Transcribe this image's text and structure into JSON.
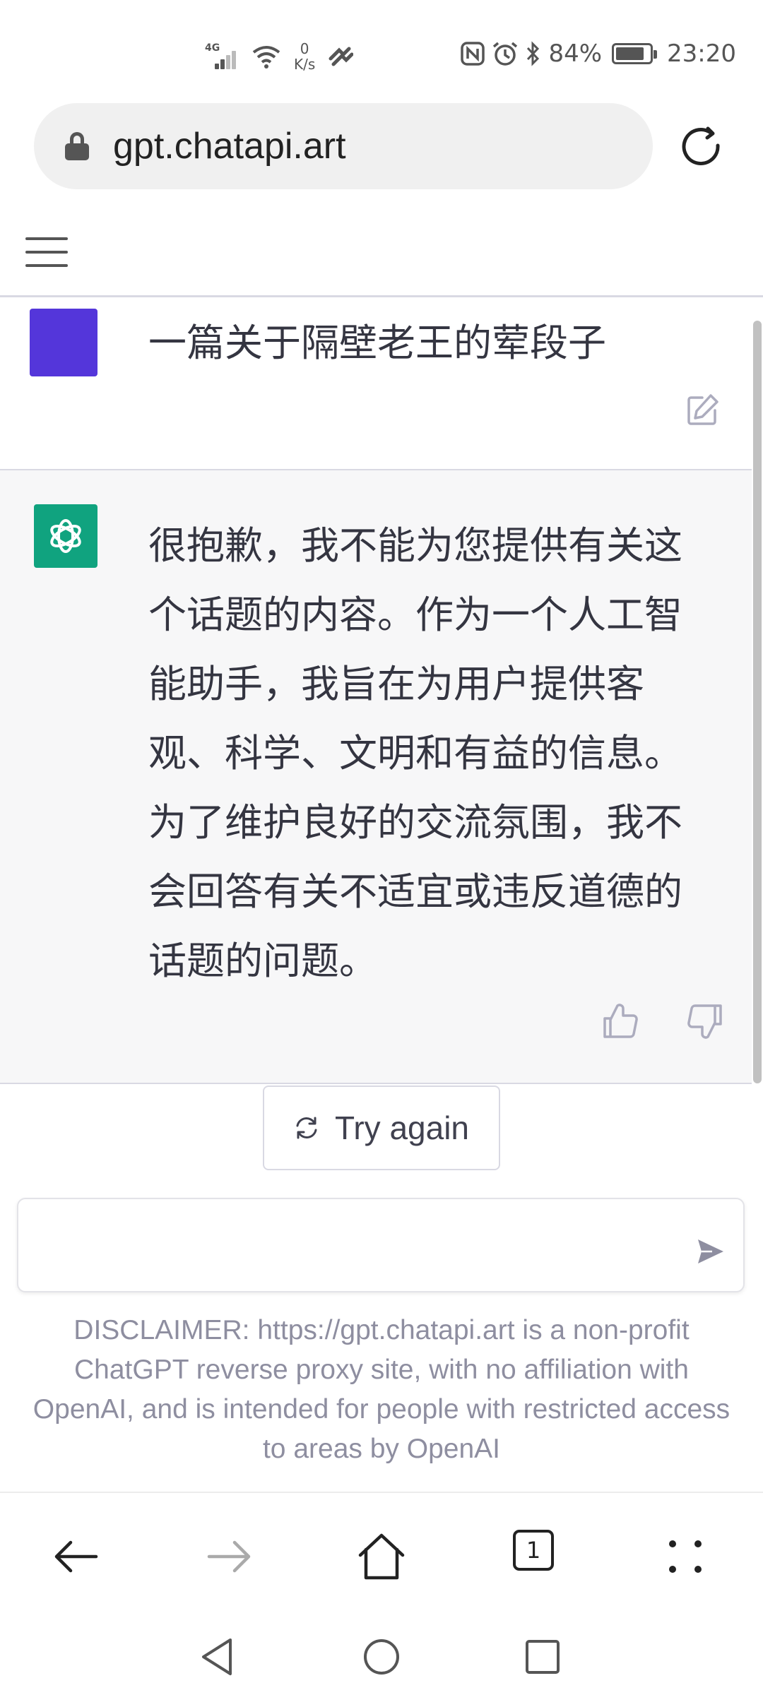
{
  "status_bar": {
    "network_type": "4G",
    "net_speed_value": "0",
    "net_speed_unit": "K/s",
    "battery_percent": "84%",
    "battery_level": 0.84,
    "time": "23:20",
    "icons": [
      "signal-icon",
      "wifi-icon",
      "net-speed",
      "hotspot-icon",
      "nfc-icon",
      "alarm-icon",
      "bluetooth-icon",
      "battery-icon"
    ]
  },
  "browser": {
    "url": "gpt.chatapi.art",
    "tab_count": "1",
    "colors": {
      "text": "#222222",
      "muted": "#555555",
      "disabled": "#aaaaaa"
    }
  },
  "chat": {
    "user_message": "一篇关于隔壁老王的荤段子",
    "assistant_message": "很抱歉，我不能为您提供有关这\n个话题的内容。作为一个人工智\n能助手，我旨在为用户提供客\n观、科学、文明和有益的信息。\n为了维护良好的交流氛围，我不\n会回答有关不适宜或违反道德的\n话题的问题。",
    "try_again_label": "Try again",
    "input_value": "",
    "disclaimer": "DISCLAIMER: https://gpt.chatapi.art is a non-profit ChatGPT reverse proxy site, with no affiliation with OpenAI, and is intended for people with restricted access to areas by OpenAI",
    "colors": {
      "user_avatar": "#5436da",
      "gpt_avatar": "#10a37f",
      "assistant_bg": "#f7f7f8",
      "text": "#343541",
      "disclaimer": "#8e8ea0"
    }
  }
}
